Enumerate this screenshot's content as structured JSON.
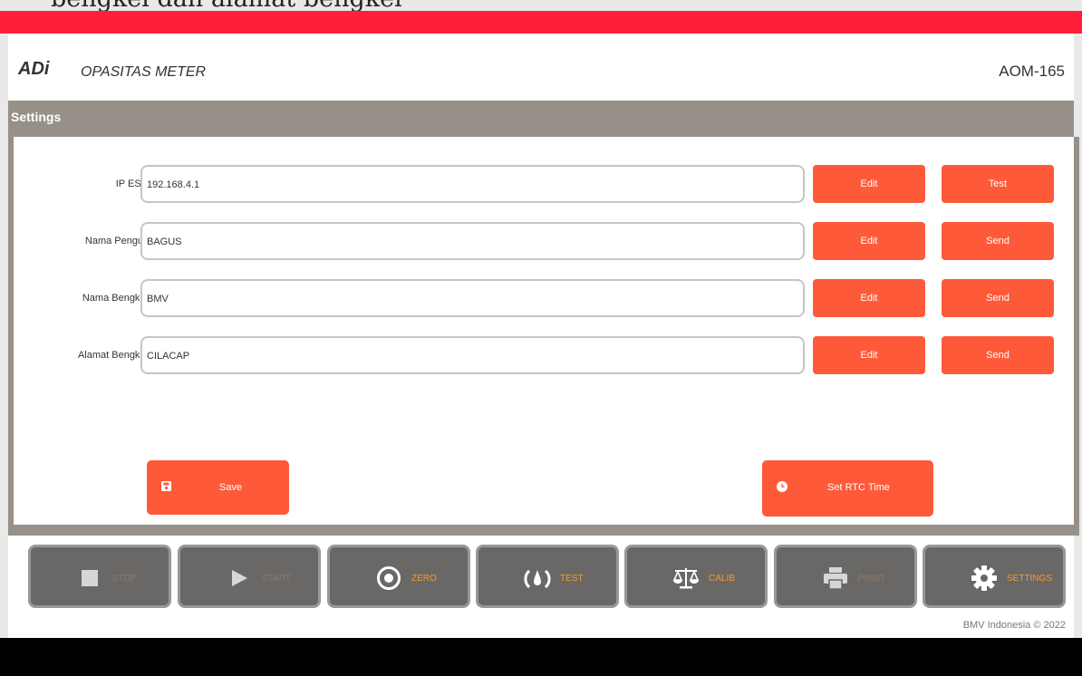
{
  "top_caption": "bengkel dan alamat bengkel",
  "header": {
    "brand": "ADi",
    "product": "OPASITAS METER",
    "model": "AOM-165"
  },
  "panel": {
    "title": "Settings"
  },
  "rows": [
    {
      "label": "IP ESP",
      "value": "192.168.4.1",
      "edit": "Edit",
      "action": "Test"
    },
    {
      "label": "Nama Penguji",
      "value": "BAGUS",
      "edit": "Edit",
      "action": "Send"
    },
    {
      "label": "Nama Bengkel",
      "value": "BMV",
      "edit": "Edit",
      "action": "Send"
    },
    {
      "label": "Alamat Bengkel",
      "value": "CILACAP",
      "edit": "Edit",
      "action": "Send"
    }
  ],
  "buttons": {
    "save": "Save",
    "rtc": "Set RTC Time"
  },
  "toolbar": [
    {
      "label": "STOP",
      "icon": "stop-icon",
      "enabled": false
    },
    {
      "label": "START",
      "icon": "play-icon",
      "enabled": false
    },
    {
      "label": "ZERO",
      "icon": "target-icon",
      "enabled": true
    },
    {
      "label": "TEST",
      "icon": "gauge-icon",
      "enabled": true
    },
    {
      "label": "CALIB",
      "icon": "balance-scale-icon",
      "enabled": true
    },
    {
      "label": "PRINT",
      "icon": "printer-icon",
      "enabled": false
    },
    {
      "label": "SETTINGS",
      "icon": "gear-icon",
      "enabled": true
    }
  ],
  "footer": "BMV Indonesia © 2022",
  "colors": {
    "accent": "#fe5a3a",
    "brand_red": "#ff1f3a",
    "panel_gray": "#979089",
    "tool_bg": "#6a6866",
    "tool_label": "#f29a2e"
  }
}
